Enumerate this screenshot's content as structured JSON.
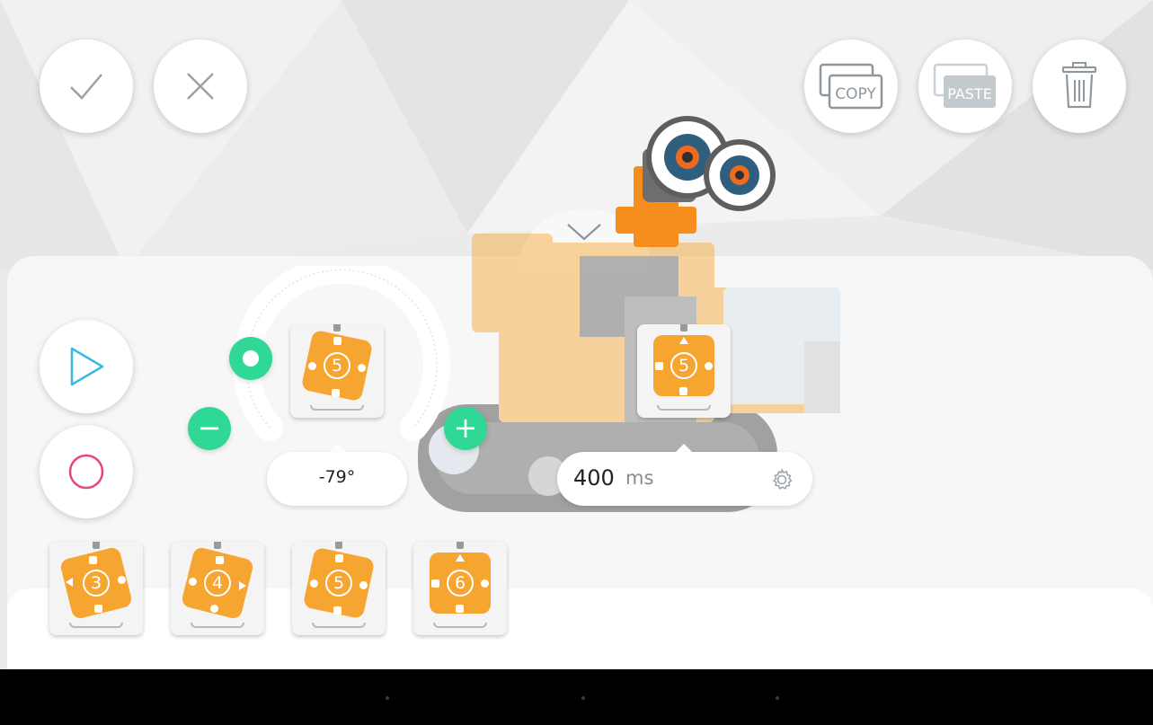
{
  "header": {
    "confirm_icon": "checkmark-icon",
    "cancel_icon": "close-icon",
    "copy_label": "COPY",
    "paste_label": "PASTE",
    "delete_icon": "trash-icon"
  },
  "playback": {
    "play_icon": "play-icon",
    "record_icon": "record-icon"
  },
  "angle_editor": {
    "servo_number": "5",
    "angle_value": "-79°",
    "minus_label": "−",
    "plus_label": "+"
  },
  "timeline": {
    "frame_servo_number": "5",
    "duration_value": "400",
    "duration_unit": "ms",
    "settings_icon": "gear-icon"
  },
  "servo_tray": [
    {
      "number": "3"
    },
    {
      "number": "4"
    },
    {
      "number": "5"
    },
    {
      "number": "6"
    }
  ],
  "colors": {
    "accent_green": "#2fd894",
    "servo_orange": "#f6a530",
    "play_blue": "#3bb8e0",
    "record_pink": "#e8457a"
  }
}
